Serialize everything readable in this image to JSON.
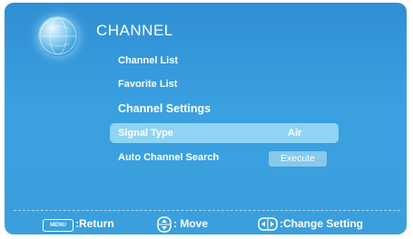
{
  "menu": {
    "title": "CHANNEL",
    "items": [
      {
        "label": "Channel List"
      },
      {
        "label": "Favorite List"
      }
    ],
    "section_heading": "Channel Settings",
    "settings": [
      {
        "label": "Signal Type",
        "value": "Air",
        "highlighted": true
      },
      {
        "label": "Auto Channel Search",
        "button": "Execute"
      }
    ]
  },
  "footer": {
    "menu_key": "MENU",
    "return_label": ":Return",
    "move_label": ": Move",
    "change_label": ":Change Setting"
  },
  "colors": {
    "background": "#3aa0e0",
    "highlight": "#90d4f4",
    "text": "#ffffff"
  },
  "icons": [
    "globe-icon",
    "up-down-icon",
    "left-right-icon"
  ]
}
